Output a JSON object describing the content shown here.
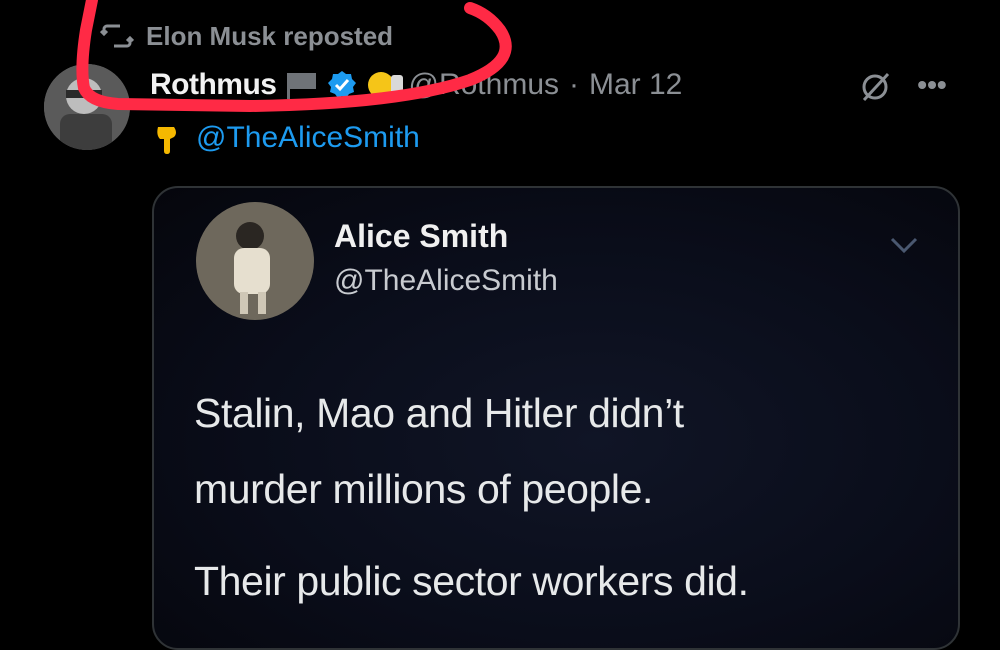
{
  "repost": {
    "label": "Elon Musk reposted",
    "icon": "repost-icon"
  },
  "tweet": {
    "author_name": "Rothmus",
    "handle": "@Rothmus",
    "separator": "·",
    "date": "Mar 12",
    "badges": [
      "flag-icon",
      "verified-icon",
      "emoji-icon"
    ],
    "reply_to_mention": "@TheAliceSmith"
  },
  "quoted_tweet": {
    "name": "Alice Smith",
    "handle": "@TheAliceSmith",
    "lines": [
      "Stalin, Mao and Hitler didn’t",
      "murder millions of people.",
      "Their public sector workers did."
    ]
  },
  "colors": {
    "background": "#000000",
    "muted_text": "#8b8f94",
    "link_blue": "#1d9bf0",
    "verified_blue": "#1d9bf0",
    "annotation_red": "#ff2a45"
  }
}
